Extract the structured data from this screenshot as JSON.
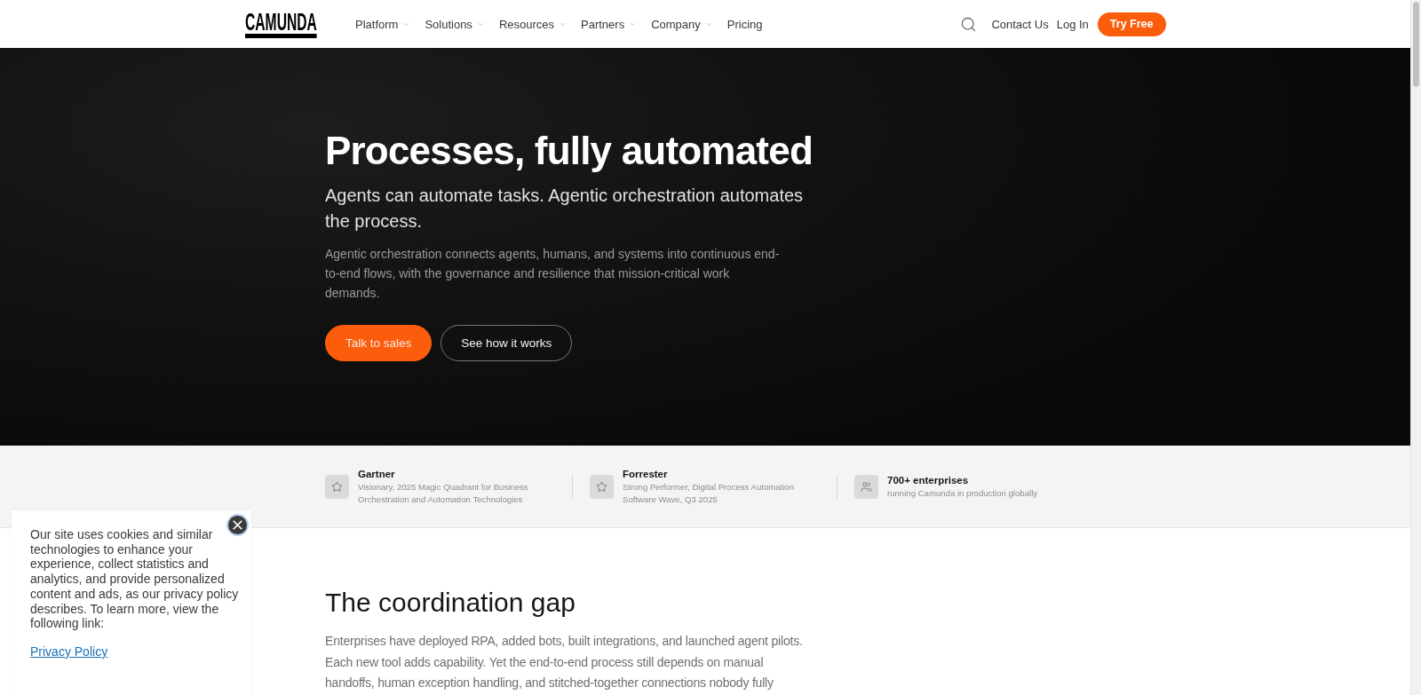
{
  "nav": {
    "logo": "CAMUNDA",
    "items": [
      {
        "label": "Platform",
        "has_menu": true
      },
      {
        "label": "Solutions",
        "has_menu": true
      },
      {
        "label": "Resources",
        "has_menu": true
      },
      {
        "label": "Partners",
        "has_menu": true
      },
      {
        "label": "Company",
        "has_menu": true
      },
      {
        "label": "Pricing",
        "has_menu": false
      }
    ],
    "links": [
      {
        "label": "Contact Us",
        "kind": "link"
      },
      {
        "label": "Log In",
        "kind": "link"
      },
      {
        "label": "Try Free",
        "kind": "button"
      }
    ]
  },
  "hero": {
    "title": "Processes, fully automated",
    "subtitle": "Agents can automate tasks. Agentic orchestration automates the process.",
    "description": "Agentic orchestration connects agents, humans, and systems into continuous end-to-end flows, with the governance and resilience that mission-critical work demands.",
    "buttons": [
      {
        "label": "Talk to sales",
        "kind": "primary"
      },
      {
        "label": "See how it works",
        "kind": "outline"
      }
    ]
  },
  "recognition": [
    {
      "kind": "analyst",
      "title": "Gartner",
      "text": "Visionary, 2025 Magic Quadrant for Business Orchestration and Automation Technologies"
    },
    {
      "kind": "analyst",
      "title": "Forrester",
      "text": "Strong Performer, Digital Process Automation Software Wave, Q3 2025"
    },
    {
      "kind": "customers",
      "title": "700+ enterprises",
      "text": "running Camunda in production globally"
    }
  ],
  "section": {
    "heading": "The coordination gap",
    "body": "Enterprises have deployed RPA, added bots, built integrations, and launched agent pilots. Each new tool adds capability. Yet the end-to-end process still depends on manual handoffs, human exception handling, and stitched-together connections nobody fully"
  },
  "cookie_notice": {
    "text": "Our site uses cookies and similar technologies to enhance your experience, collect statistics and analytics, and provide personalized content and ads, as our privacy policy describes. To learn more, view the following link:",
    "link": "Privacy Policy"
  }
}
